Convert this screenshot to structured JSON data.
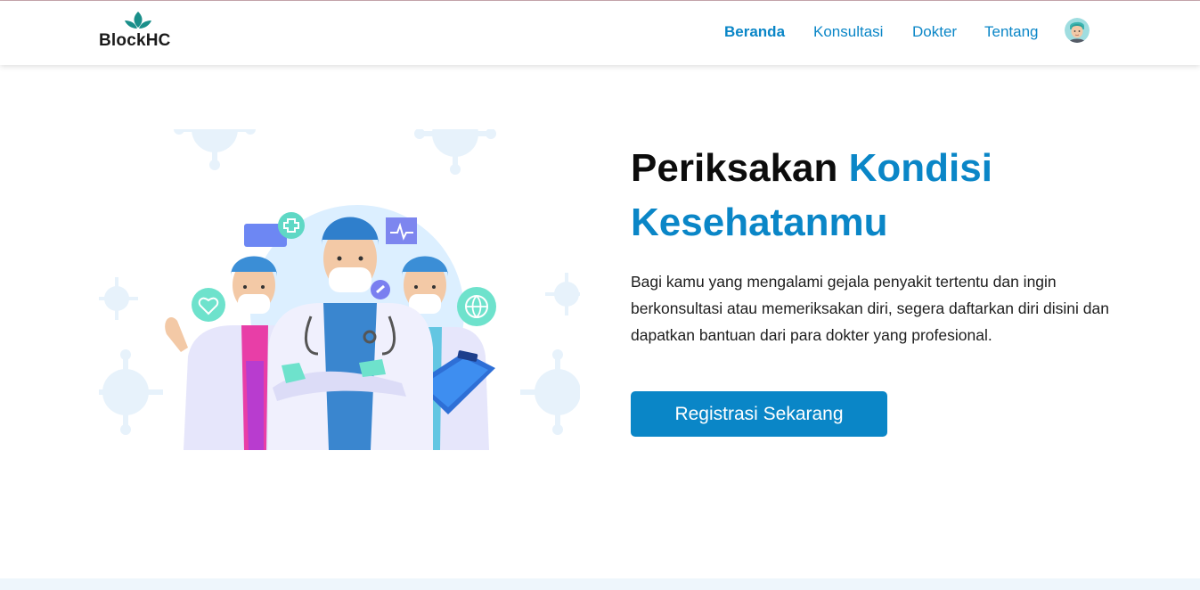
{
  "navbar": {
    "brand": "BlockHC",
    "links": [
      {
        "label": "Beranda",
        "active": true
      },
      {
        "label": "Konsultasi",
        "active": false
      },
      {
        "label": "Dokter",
        "active": false
      },
      {
        "label": "Tentang",
        "active": false
      }
    ],
    "avatar_icon": "user-avatar-icon"
  },
  "hero": {
    "title_part1": "Periksakan ",
    "title_part2": "Kondisi Kesehatanmu",
    "description": "Bagi kamu yang mengalami gejala penyakit tertentu dan ingin berkonsultasi atau memeriksakan diri, segera daftarkan diri disini dan dapatkan bantuan dari para dokter yang profesional.",
    "cta_label": "Registrasi Sekarang",
    "illustration_icon": "medical-team-illustration"
  },
  "colors": {
    "accent": "#0a86c7",
    "text": "#0c0c0c",
    "logo_leaf": "#1a8f8a"
  }
}
